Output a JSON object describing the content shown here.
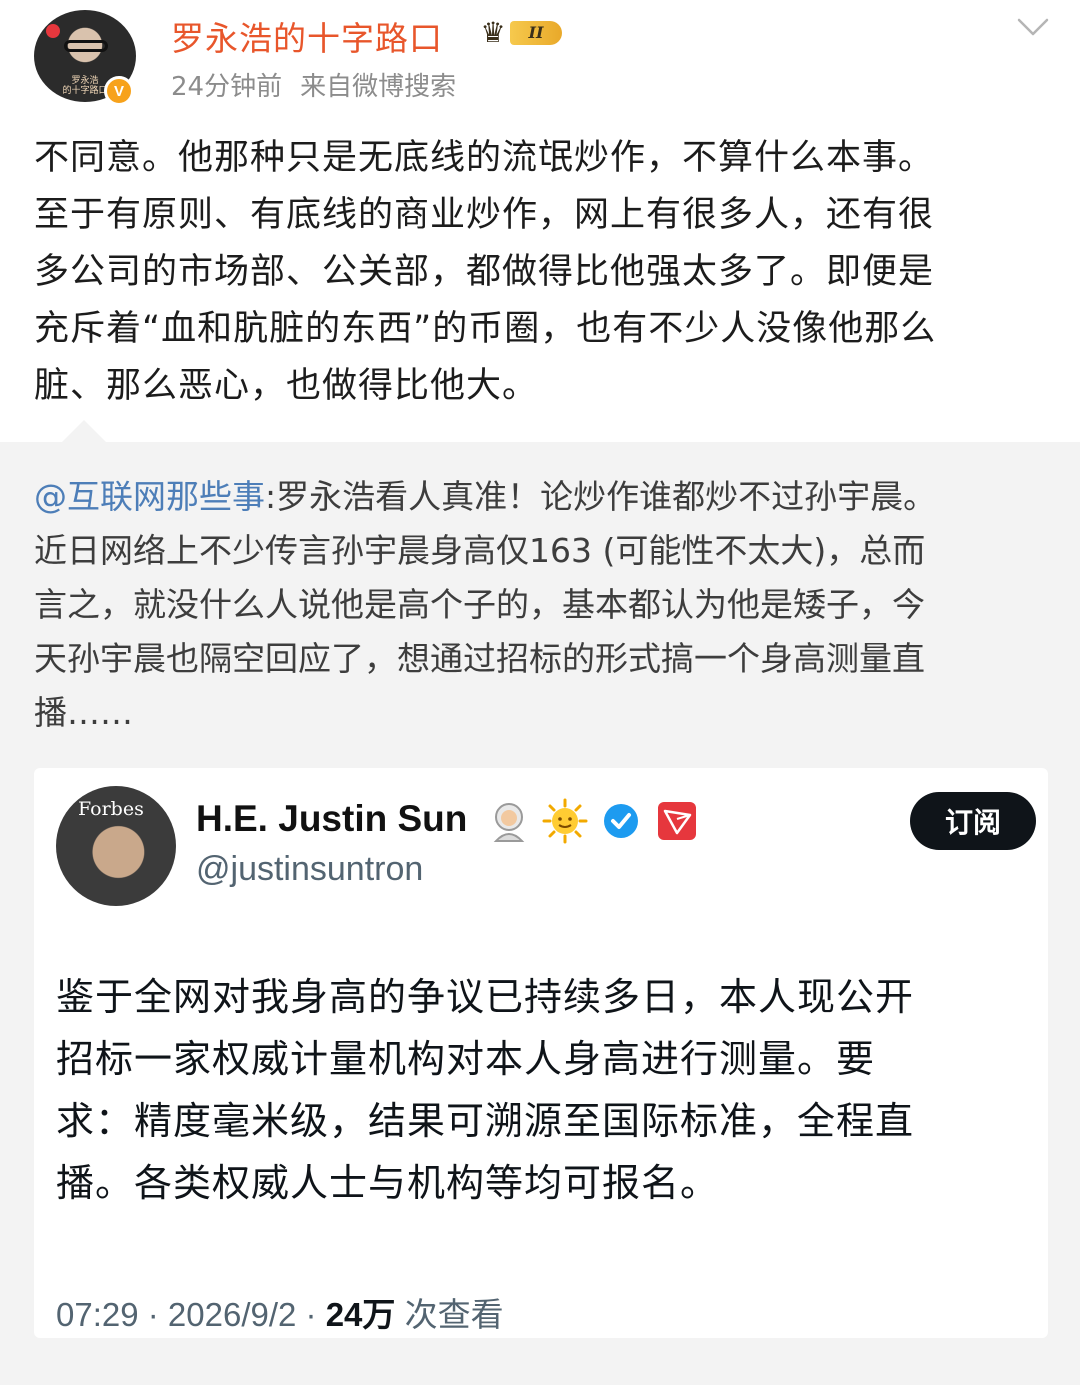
{
  "post": {
    "username": "罗永浩的十字路口",
    "badge_level": "II",
    "avatar_caption_line1": "罗永浩",
    "avatar_caption_line2": "的十字路口",
    "verified_mark": "V",
    "time": "24分钟前",
    "source": "来自微博搜索",
    "text_lines": [
      "不同意。他那种只是无底线的流氓炒作，不算什么本事。",
      "至于有原则、有底线的商业炒作，网上有很多人，还有很",
      "多公司的市场部、公关部，都做得比他强太多了。即便是",
      "充斥着“血和肮脏的东西”的币圈，也有不少人没像他那么",
      "脏、那么恶心，也做得比他大。"
    ]
  },
  "repost": {
    "mention": "@互联网那些事",
    "text_first": ":罗永浩看人真准！论炒作谁都炒不过孙宇晨。",
    "text_lines": [
      "近日网络上不少传言孙宇晨身高仅163 (可能性不太大)，总而",
      "言之，就没什么人说他是高个子的，基本都认为他是矮子，今",
      "天孙宇晨也隔空回应了，想通过招标的形式搞一个身高测量直",
      "播……"
    ]
  },
  "tweet": {
    "avatar_text": "Forbes",
    "name": "H.E. Justin Sun",
    "handle": "@justinsuntron",
    "subscribe_label": "订阅",
    "body_lines": [
      "鉴于全网对我身高的争议已持续多日，本人现公开",
      "招标一家权威计量机构对本人身高进行测量。要",
      "求：精度毫米级，结果可溯源至国际标准，全程直",
      "播。各类权威人士与机构等均可报名。"
    ],
    "time": "07:29 · 2026/9/2 · ",
    "views": "24万",
    "views_suffix": " 次查看",
    "icons": [
      "astronaut-emoji-icon",
      "sun-emoji-icon",
      "verified-check-icon",
      "tron-logo-icon"
    ]
  },
  "colors": {
    "username": "#e8562b",
    "mention": "#4d7eb8",
    "repost_bg": "#f3f3f3",
    "verified_blue": "#1d9bf0",
    "tron_red": "#e6373d"
  }
}
